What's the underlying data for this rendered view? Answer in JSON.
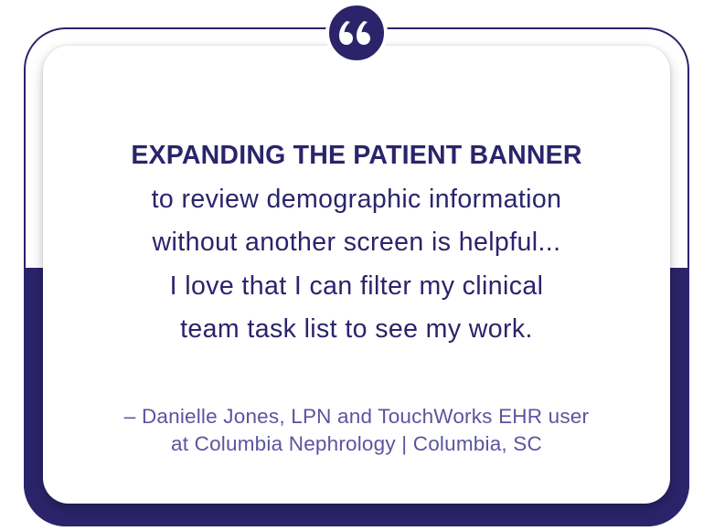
{
  "colors": {
    "navy": "#2b246b",
    "attribution_purple": "#5a55a0",
    "background": "#ffffff"
  },
  "badge": {
    "icon": "quotation-mark-icon"
  },
  "quote": {
    "headline": "EXPANDING THE PATIENT BANNER",
    "lines": [
      "to review demographic information",
      "without another screen is helpful...",
      "I love that I can filter my clinical",
      "team task list to see my work."
    ]
  },
  "attribution": {
    "lines": [
      "– Danielle Jones, LPN and TouchWorks EHR user",
      "at Columbia Nephrology | Columbia, SC"
    ]
  }
}
